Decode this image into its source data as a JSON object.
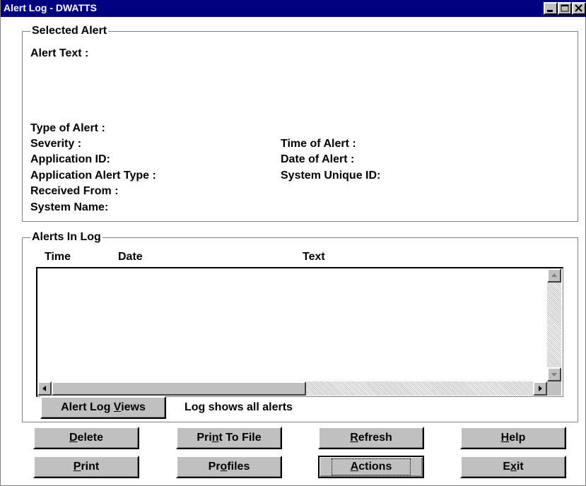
{
  "window": {
    "title": "Alert Log - DWATTS",
    "minimize_icon": "minimize-icon",
    "maximize_icon": "maximize-icon",
    "close_icon": "close-icon"
  },
  "selected_alert": {
    "group_label": "Selected Alert",
    "alert_text_label": "Alert Text :",
    "type_of_alert_label": "Type of Alert :",
    "severity_label": "Severity :",
    "application_id_label": "Application ID:",
    "application_alert_type_label": "Application Alert Type :",
    "received_from_label": "Received From :",
    "system_name_label": "System Name:",
    "time_of_alert_label": "Time of Alert :",
    "date_of_alert_label": "Date of Alert :",
    "system_unique_id_label": "System Unique ID:"
  },
  "alerts_in_log": {
    "group_label": "Alerts In Log",
    "columns": [
      "Time",
      "Date",
      "Text"
    ],
    "rows": []
  },
  "views": {
    "button_pre": "Alert Log ",
    "button_mnemonic": "V",
    "button_post": "iews",
    "status_text": "Log shows all alerts"
  },
  "buttons": {
    "delete": {
      "pre": "",
      "mn": "D",
      "post": "elete"
    },
    "print_to_file": {
      "pre": "Pri",
      "mn": "n",
      "post": "t To File"
    },
    "refresh": {
      "pre": "",
      "mn": "R",
      "post": "efresh"
    },
    "help": {
      "pre": "",
      "mn": "H",
      "post": "elp"
    },
    "print": {
      "pre": "",
      "mn": "P",
      "post": "rint"
    },
    "profiles": {
      "pre": "Pr",
      "mn": "o",
      "post": "files"
    },
    "actions": {
      "pre": "",
      "mn": "A",
      "post": "ctions"
    },
    "exit": {
      "pre": "E",
      "mn": "x",
      "post": "it"
    }
  },
  "colors": {
    "title_bar": "#000080",
    "button_face": "#c0c0c0",
    "background": "#ffffff"
  }
}
